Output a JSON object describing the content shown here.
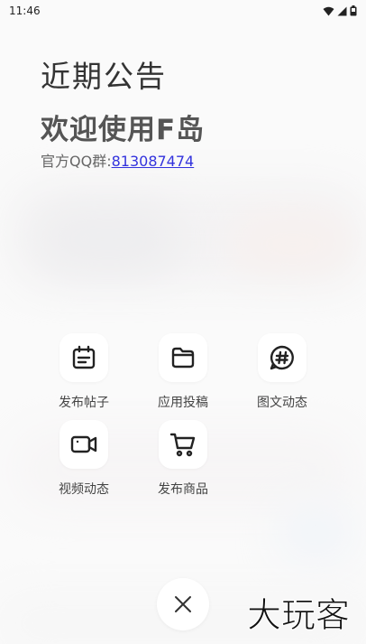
{
  "status_bar": {
    "time": "11:46"
  },
  "notice": {
    "heading": "近期公告",
    "welcome": "欢迎使用F岛",
    "qq_prefix": "官方QQ群:",
    "qq_number": "813087474"
  },
  "actions": [
    {
      "label": "发布帖子",
      "icon": "calendar-note-icon"
    },
    {
      "label": "应用投稿",
      "icon": "folder-icon"
    },
    {
      "label": "图文动态",
      "icon": "hashtag-bubble-icon"
    },
    {
      "label": "视频动态",
      "icon": "video-camera-icon"
    },
    {
      "label": "发布商品",
      "icon": "shopping-cart-icon"
    }
  ],
  "close": {
    "icon": "close-icon"
  },
  "watermark": {
    "text": "大玩客"
  }
}
